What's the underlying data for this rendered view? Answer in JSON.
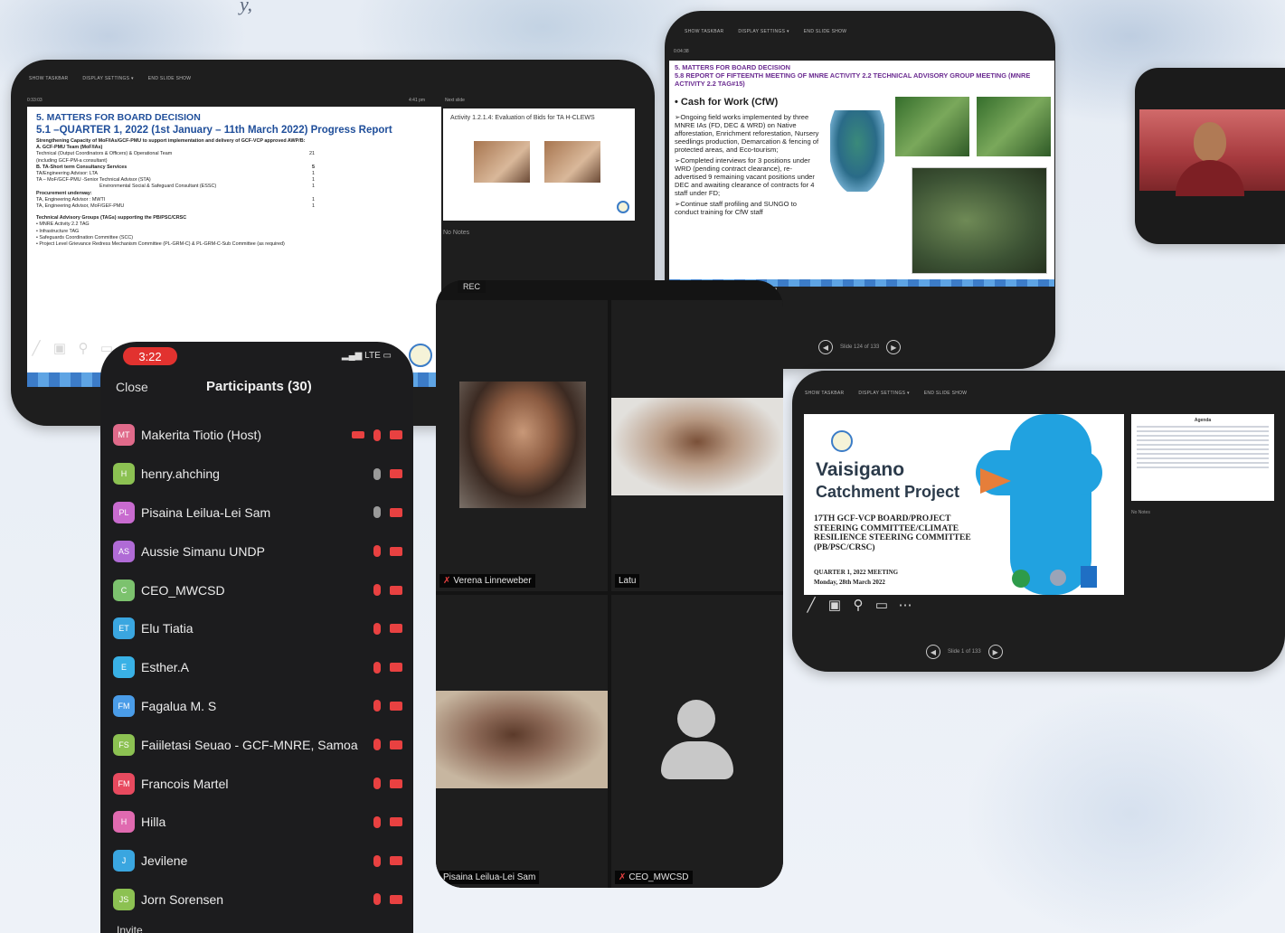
{
  "background": {
    "caption": "y,"
  },
  "left_slide": {
    "toolbar": [
      "SHOW TASKBAR",
      "DISPLAY SETTINGS ▾",
      "END SLIDE SHOW"
    ],
    "timer": "0:33:03",
    "clock": "4:41 pm",
    "next_slide_label": "Next slide",
    "heading1": "5. MATTERS FOR BOARD DECISION",
    "heading2": "5.1 –QUARTER 1, 2022 (1st January – 11th March 2022) Progress Report",
    "intro": "Strengthening Capacity of MoF/IAs/GCF-PMU to support implementation and delivery of GCF-VCP approved AWP/B:",
    "section_a": "A. GCF-PMU Team (MoF/IAs)",
    "row_a1": {
      "label": "Technical (Output Coordinators & Officers) & Operational Team",
      "count": "21"
    },
    "row_a2": "(including GCF-PM-a consultant)",
    "section_b": "B. TA-Short term Consultancy Services",
    "row_b0": {
      "label": "",
      "count": "5"
    },
    "row_b1": {
      "label": "TA/Engineering Advisor: LTA",
      "count": "1"
    },
    "row_b2": {
      "label": "TA – MoF/GCF-PMU -Senior Technical Advisor (STA)",
      "count": "1"
    },
    "row_b3": {
      "label": "Environmental Social & Safeguard Consultant (ESSC)",
      "count": "1"
    },
    "section_c": "Procurement underway:",
    "row_c1": {
      "label": "TA, Engineering Advisor : MWTI",
      "count": "1"
    },
    "row_c2": {
      "label": "TA, Engineering Advisor, MoF/GEF-PMU",
      "count": "1"
    },
    "section_d": "Technical Advisory Groups (TAGs) supporting the PB/PSC/CRSC",
    "bullets": [
      "MNRE Activity 2.2 TAG",
      "Infrastructure TAG",
      "Safeguards Coordination Committee (SCC)",
      "Project Level Grievance Redress Mechanism Committee (PL-GRM-C) & PL-GRM-C-Sub Committee (as required)"
    ],
    "next_title": "Activity 1.2.1.4: Evaluation of Bids for TA H-CLEWS",
    "no_notes": "No Notes"
  },
  "right_slide": {
    "toolbar": [
      "SHOW TASKBAR",
      "DISPLAY SETTINGS ▾",
      "END SLIDE SHOW"
    ],
    "timer": "0:04:38",
    "heading1": "5. MATTERS FOR BOARD DECISION",
    "heading2": "5.8 REPORT OF FIFTEENTH MEETING OF MNRE ACTIVITY 2.2 TECHNICAL ADVISORY GROUP MEETING (MNRE ACTIVITY 2.2 TAG#15)",
    "subheading": "• Cash for Work (CfW)",
    "bullets": [
      "➢Ongoing field works implemented by three MNRE IAs (FD, DEC & WRD) on Native afforestation, Enrichment reforestation, Nursery seedlings production, Demarcation & fencing of protected areas, and Eco-tourism;",
      "➢Completed interviews for 3 positions under WRD (pending contract clearance), re-advertised 9 remaining vacant positions under DEC and awaiting clearance of contracts for 4 staff under FD;",
      "➢Continue staff profiling and SUNGO to conduct training for CfW staff"
    ],
    "pager": "Slide 124 of 133"
  },
  "title_slide": {
    "toolbar": [
      "SHOW TASKBAR",
      "DISPLAY SETTINGS ▾",
      "END SLIDE SHOW"
    ],
    "title1": "Vaisigano",
    "title2": "Catchment Project",
    "subtitle": "17TH GCF-VCP BOARD/PROJECT STEERING COMMITTEE/CLIMATE RESILIENCE STEERING COMMITTEE (PB/PSC/CRSC)",
    "meeting": "QUARTER 1, 2022 MEETING",
    "date": "Monday, 28th March 2022",
    "next_heading": "Agenda",
    "no_notes": "No Notes",
    "pager": "Slide 1 of 133"
  },
  "phone": {
    "time": "3:22",
    "network": "LTE",
    "close_label": "Close",
    "title": "Participants (30)",
    "invite_label": "Invite",
    "participants": [
      {
        "initials": "MT",
        "name": "Makerita Tiotio (Host)",
        "color": "#e06a8a",
        "mic": "red",
        "rec": true
      },
      {
        "initials": "H",
        "name": "henry.ahching",
        "color": "#8cc152",
        "mic": "gray",
        "rec": false
      },
      {
        "initials": "PL",
        "name": "Pisaina Leilua-Lei Sam",
        "color": "#c86bcf",
        "mic": "gray",
        "rec": false
      },
      {
        "initials": "AS",
        "name": "Aussie Simanu UNDP",
        "color": "#b06bd6",
        "mic": "red",
        "rec": false
      },
      {
        "initials": "C",
        "name": "CEO_MWCSD",
        "color": "#7cc26e",
        "mic": "red",
        "rec": false
      },
      {
        "initials": "ET",
        "name": "Elu Tiatia",
        "color": "#3aa6e0",
        "mic": "red",
        "rec": false
      },
      {
        "initials": "E",
        "name": "Esther.A",
        "color": "#39b1e6",
        "mic": "red",
        "rec": false
      },
      {
        "initials": "FM",
        "name": "Fagalua M. S",
        "color": "#4a9ce8",
        "mic": "red",
        "rec": false
      },
      {
        "initials": "FS",
        "name": "Faiiletasi Seuao - GCF-MNRE, Samoa",
        "color": "#8cc152",
        "mic": "red",
        "rec": false
      },
      {
        "initials": "FM",
        "name": "Francois Martel",
        "color": "#e84a5f",
        "mic": "red",
        "rec": false
      },
      {
        "initials": "H",
        "name": "Hilla",
        "color": "#e06ab0",
        "mic": "red",
        "rec": false
      },
      {
        "initials": "J",
        "name": "Jevilene",
        "color": "#3aa6e0",
        "mic": "red",
        "rec": false
      },
      {
        "initials": "JS",
        "name": "Jorn Sorensen",
        "color": "#8cc152",
        "mic": "red",
        "rec": false
      }
    ]
  },
  "gallery": {
    "rec_tab": "REC",
    "tiles": [
      {
        "label": "Verena Linneweber",
        "muted": true
      },
      {
        "label": "Latu",
        "muted": false
      },
      {
        "label": "Pisaina Leilua-Lei Sam",
        "muted": false
      },
      {
        "label": "CEO_MWCSD",
        "muted": true
      }
    ]
  }
}
